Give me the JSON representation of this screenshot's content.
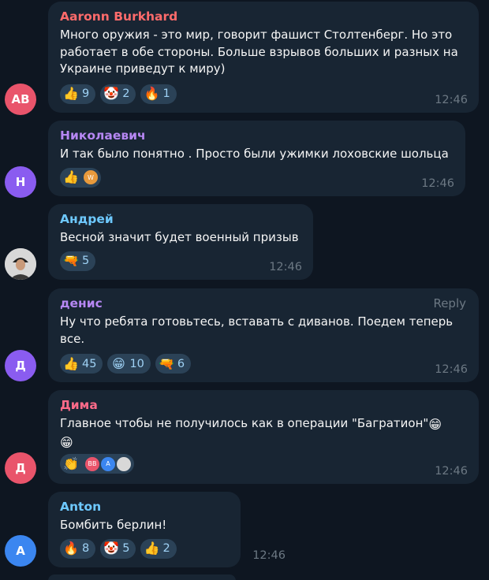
{
  "messages": [
    {
      "author": "Aaronn Burkhard",
      "author_color": "#ff6b6b",
      "avatar": {
        "initials": "AB",
        "color": "#e9546b"
      },
      "lines": [
        "Много оружия - это мир, говорит фашист Столтенберг. Но это",
        "работает в обе стороны. Больше взрывов больших и разных на",
        "Украине приведут к миру)"
      ],
      "reactions": [
        {
          "icon": "thumbs-up-icon",
          "glyph": "👍",
          "count": "9"
        },
        {
          "icon": "clown-face-icon",
          "glyph": "🤡",
          "count": "2"
        },
        {
          "icon": "fire-icon",
          "glyph": "🔥",
          "count": "1"
        }
      ],
      "time": "12:46"
    },
    {
      "author": "Николаевич",
      "author_color": "#b687f3",
      "avatar": {
        "initials": "Н",
        "color": "#8a5cf0"
      },
      "lines": [
        "И так было понятно . Просто были ужимки лоховские  шольца"
      ],
      "reactions": [
        {
          "icon": "thumbs-up-icon",
          "glyph": "👍",
          "count": "",
          "reactor_initials": "W"
        }
      ],
      "time": "12:46"
    },
    {
      "author": "Андрей",
      "author_color": "#6ec9ff",
      "avatar": {
        "initials": "",
        "color": "#dcdcdc"
      },
      "lines": [
        "Весной значит будет военный призыв"
      ],
      "reactions": [
        {
          "icon": "pistol-icon",
          "glyph": "🔫",
          "count": "5"
        }
      ],
      "time": "12:46"
    },
    {
      "author": "денис",
      "author_color": "#b687f3",
      "avatar": {
        "initials": "Д",
        "color": "#8a5cf0"
      },
      "reply_label": "Reply",
      "lines": [
        "Ну что ребята готовьтесь, вставать с диванов. Поедем теперь",
        "все."
      ],
      "reactions": [
        {
          "icon": "thumbs-up-icon",
          "glyph": "👍",
          "count": "45"
        },
        {
          "icon": "grinning-face-icon",
          "glyph": "😁",
          "count": "10"
        },
        {
          "icon": "pistol-icon",
          "glyph": "🔫",
          "count": "6"
        }
      ],
      "time": "12:46"
    },
    {
      "author": "Дима",
      "author_color": "#ff6b8a",
      "avatar": {
        "initials": "Д",
        "color": "#e9546b"
      },
      "lines": [
        "Главное чтобы не получилось как в операции \"Багратион\""
      ],
      "inline_emoji": "😁",
      "second_line_emoji": "😁",
      "reactions": [
        {
          "icon": "clapping-hands-icon",
          "glyph": "👏",
          "count": "",
          "reactor_initials": [
            "BB",
            "A",
            ""
          ]
        }
      ],
      "time": "12:46"
    },
    {
      "author": "Anton",
      "author_color": "#6ec9ff",
      "avatar": {
        "initials": "A",
        "color": "#3b86f0"
      },
      "lines": [
        "Бомбить берлин!"
      ],
      "reactions": [
        {
          "icon": "fire-icon",
          "glyph": "🔥",
          "count": "8"
        },
        {
          "icon": "clown-face-icon",
          "glyph": "🤡",
          "count": "5"
        },
        {
          "icon": "thumbs-up-icon",
          "glyph": "👍",
          "count": "2"
        }
      ],
      "time": "12:46"
    }
  ]
}
